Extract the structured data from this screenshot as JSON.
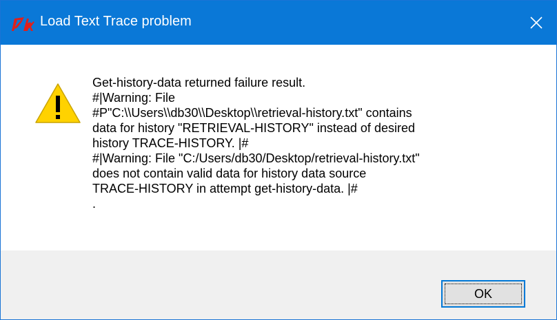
{
  "window": {
    "title": "Load Text Trace problem",
    "app_icon": "tk-feather-icon",
    "close_icon": "close-icon",
    "titlebar_color": "#0a78d7"
  },
  "message": {
    "icon": "warning-icon",
    "lines": [
      "Get-history-data returned failure result.",
      "#|Warning: File",
      "#P\"C:\\\\Users\\\\db30\\\\Desktop\\\\retrieval-history.txt\" contains",
      "data for history \"RETRIEVAL-HISTORY\" instead of desired",
      "history TRACE-HISTORY. |#",
      "#|Warning: File \"C:/Users/db30/Desktop/retrieval-history.txt\"",
      "does not contain valid data for history data source",
      "TRACE-HISTORY in attempt get-history-data. |#",
      "."
    ]
  },
  "buttons": {
    "ok_label": "OK"
  }
}
